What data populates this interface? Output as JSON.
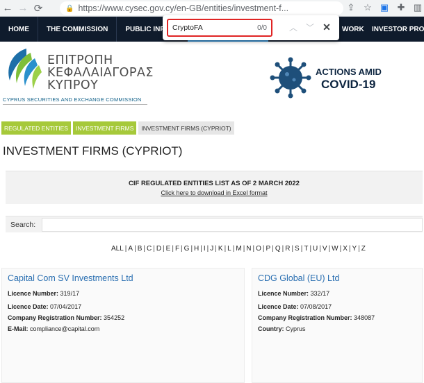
{
  "browser": {
    "url": "https://www.cysec.gov.cy/en-GB/entities/investment-f...",
    "find": {
      "query": "CryptoFA",
      "count": "0/0"
    }
  },
  "nav": {
    "items": [
      "HOME",
      "THE COMMISSION",
      "PUBLIC INFORMA"
    ],
    "right_items": [
      "WORK",
      "INVESTOR PROTE"
    ]
  },
  "header": {
    "logo_lines": [
      "ΕΠΙΤΡΟΠΗ",
      "ΚΕΦΑΛΑΙΑΓΟΡΑΣ",
      "ΚΥΠΡΟΥ"
    ],
    "logo_en": "CYPRUS SECURITIES AND EXCHANGE COMMISSION",
    "covid_line1": "ACTIONS AMID",
    "covid_line2": "COVID-19"
  },
  "breadcrumbs": [
    "REGULATED ENTITIES",
    "INVESTMENT FIRMS",
    "INVESTMENT FIRMS (CYPRIOT)"
  ],
  "page_title": "INVESTMENT FIRMS (CYPRIOT)",
  "cif": {
    "title": "CIF REGULATED ENTITIES LIST AS OF 2 MARCH 2022",
    "link": "Click here to download in Excel format"
  },
  "search": {
    "label": "Search:",
    "value": ""
  },
  "alphabet": [
    "ALL",
    "A",
    "B",
    "C",
    "D",
    "E",
    "F",
    "G",
    "H",
    "I",
    "J",
    "K",
    "L",
    "M",
    "N",
    "O",
    "P",
    "Q",
    "R",
    "S",
    "T",
    "U",
    "V",
    "W",
    "X",
    "Y",
    "Z"
  ],
  "firms": [
    {
      "name": "Capital Com SV Investments Ltd",
      "fields": [
        {
          "label": "Licence Number",
          "value": "319/17"
        },
        {
          "label": "Licence Date",
          "value": "07/04/2017"
        },
        {
          "label": "Company Registration Number",
          "value": "354252"
        },
        {
          "label": "E-Mail",
          "value": "compliance@capital.com"
        }
      ]
    },
    {
      "name": "CDG Global (EU) Ltd",
      "fields": [
        {
          "label": "Licence Number",
          "value": "332/17"
        },
        {
          "label": "Licence Date",
          "value": "07/08/2017"
        },
        {
          "label": "Company Registration Number",
          "value": "348087"
        },
        {
          "label": "Country",
          "value": "Cyprus"
        }
      ]
    }
  ],
  "colors": {
    "nav_bg": "#0f1b2c",
    "crumb_green": "#a6c93a",
    "link_blue": "#2a6fb1"
  }
}
